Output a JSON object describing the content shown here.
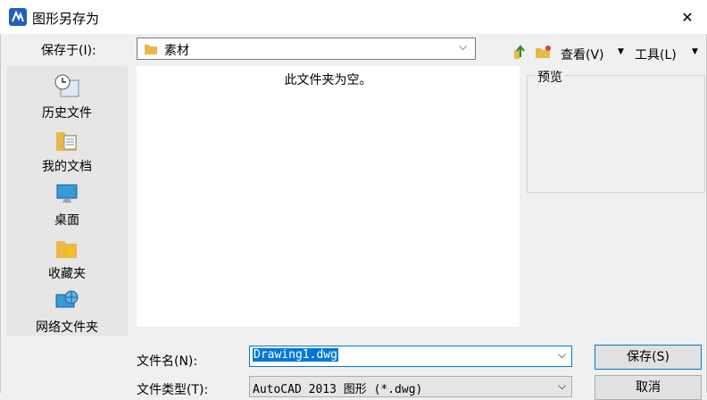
{
  "window": {
    "title": "图形另存为",
    "close_glyph": "✕"
  },
  "toolbar": {
    "save_in_label": "保存于(I):",
    "save_in_value": "素材",
    "view_label": "查看(V)",
    "tools_label": "工具(L)",
    "icons": [
      "up-folder-icon",
      "new-folder-icon"
    ]
  },
  "places": [
    {
      "label": "历史文件",
      "icon": "history-icon"
    },
    {
      "label": "我的文档",
      "icon": "documents-icon"
    },
    {
      "label": "桌面",
      "icon": "desktop-icon"
    },
    {
      "label": "收藏夹",
      "icon": "favorites-icon"
    },
    {
      "label": "网络文件夹",
      "icon": "network-folder-icon"
    }
  ],
  "file_list": {
    "empty_message": "此文件夹为空。"
  },
  "preview": {
    "label": "预览"
  },
  "form": {
    "filename_label": "文件名(N):",
    "filename_value": "Drawing1.dwg",
    "filetype_label": "文件类型(T):",
    "filetype_value": "AutoCAD 2013 图形 (*.dwg)",
    "save_label": "保存(S)",
    "cancel_label": "取消"
  },
  "colors": {
    "accent": "#0078d7",
    "background": "#f0f0f0",
    "places_bg": "#e6e6e6"
  }
}
